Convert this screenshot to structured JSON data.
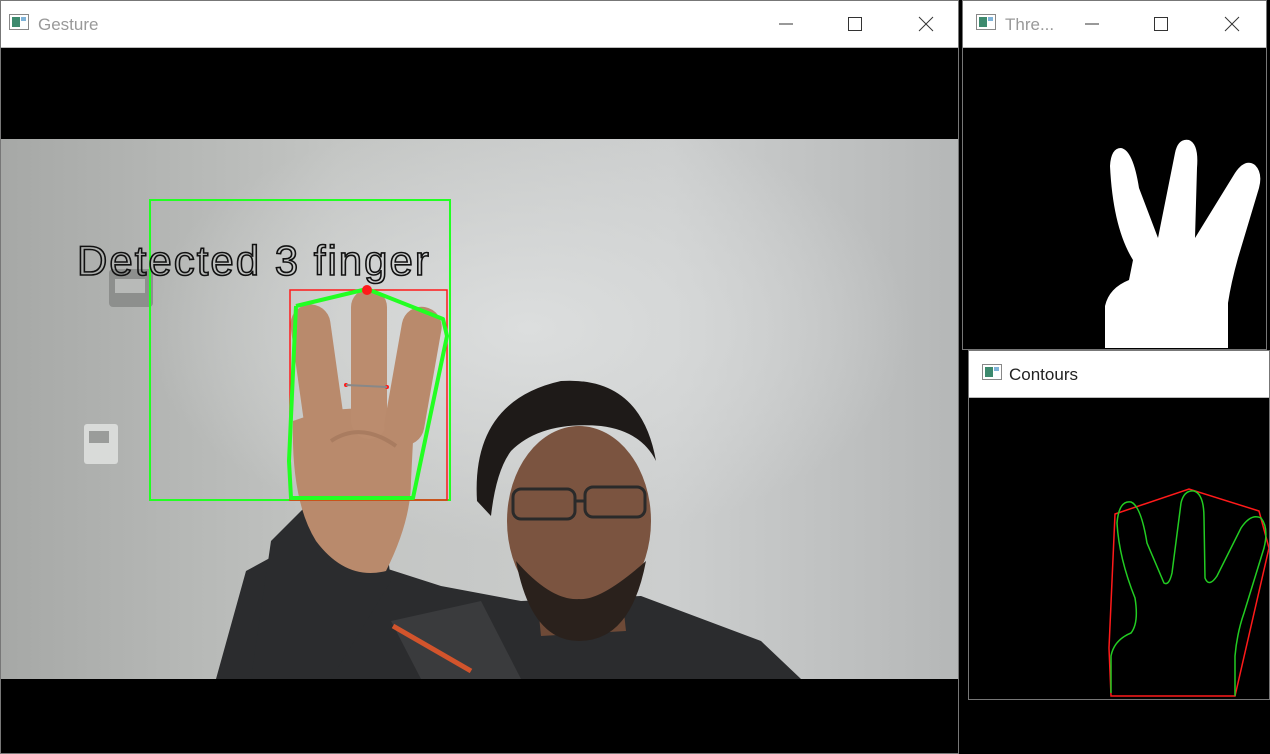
{
  "windows": {
    "gesture": {
      "title": "Gesture"
    },
    "threshold": {
      "title": "Thre..."
    },
    "contours": {
      "title": "Contours"
    }
  },
  "overlay": {
    "detected_text": "Detected 3 finger"
  },
  "colors": {
    "detection_green": "#22ff22",
    "hull_red": "#ff1a1a",
    "titlebar": "#ffffff",
    "background": "#000000"
  },
  "icons": {
    "app": "opencv-window-icon",
    "minimize": "minimize-icon",
    "maximize": "maximize-icon",
    "close": "close-icon"
  }
}
